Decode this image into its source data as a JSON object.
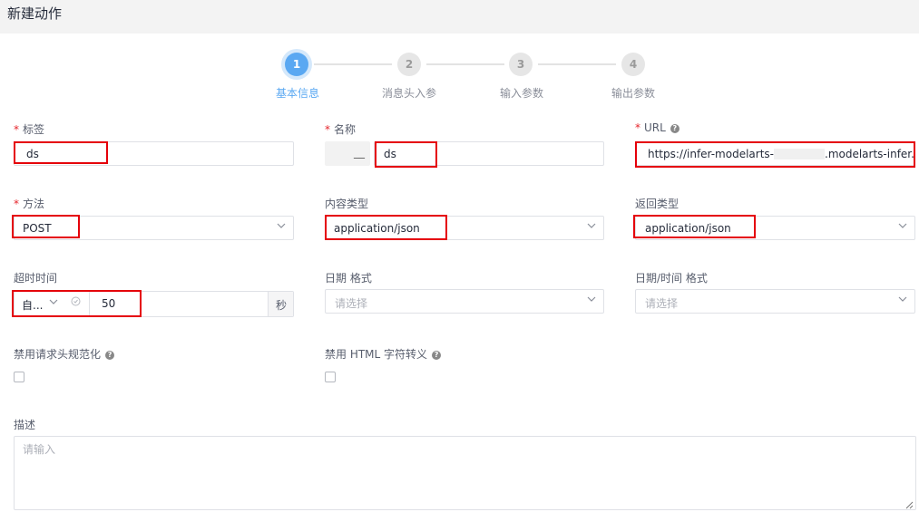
{
  "header": {
    "title": "新建动作"
  },
  "steps": [
    {
      "num": "1",
      "label": "基本信息"
    },
    {
      "num": "2",
      "label": "消息头入参"
    },
    {
      "num": "3",
      "label": "输入参数"
    },
    {
      "num": "4",
      "label": "输出参数"
    }
  ],
  "form": {
    "tag": {
      "required": "*",
      "label": "标签",
      "value": "ds"
    },
    "name": {
      "required": "*",
      "label": "名称",
      "prefix": "__",
      "value": "ds"
    },
    "url": {
      "required": "*",
      "label": "URL",
      "help": "?",
      "value": "https://infer-modelarts-",
      "value_suffix": ".modelarts-infer.c"
    },
    "method": {
      "required": "*",
      "label": "方法",
      "value": "POST"
    },
    "content_type": {
      "label": "内容类型",
      "value": "application/json"
    },
    "return_type": {
      "label": "返回类型",
      "value": "application/json"
    },
    "timeout": {
      "label": "超时时间",
      "mode": "自...",
      "value": "50",
      "unit": "秒"
    },
    "date_format": {
      "label": "日期 格式",
      "placeholder": "请选择"
    },
    "datetime_format": {
      "label": "日期/时间 格式",
      "placeholder": "请选择"
    },
    "disable_header_norm": {
      "label": "禁用请求头规范化",
      "help": "?",
      "checked": false
    },
    "disable_html_escape": {
      "label": "禁用 HTML 字符转义",
      "help": "?",
      "checked": false
    },
    "description": {
      "label": "描述",
      "placeholder": "请输入"
    }
  },
  "colors": {
    "accent": "#5aa8f2",
    "required": "#e5252b",
    "highlight": "#e5000a"
  },
  "icons": [
    "chevron-down-icon",
    "clock-icon",
    "help-icon",
    "resize-handle-icon"
  ]
}
